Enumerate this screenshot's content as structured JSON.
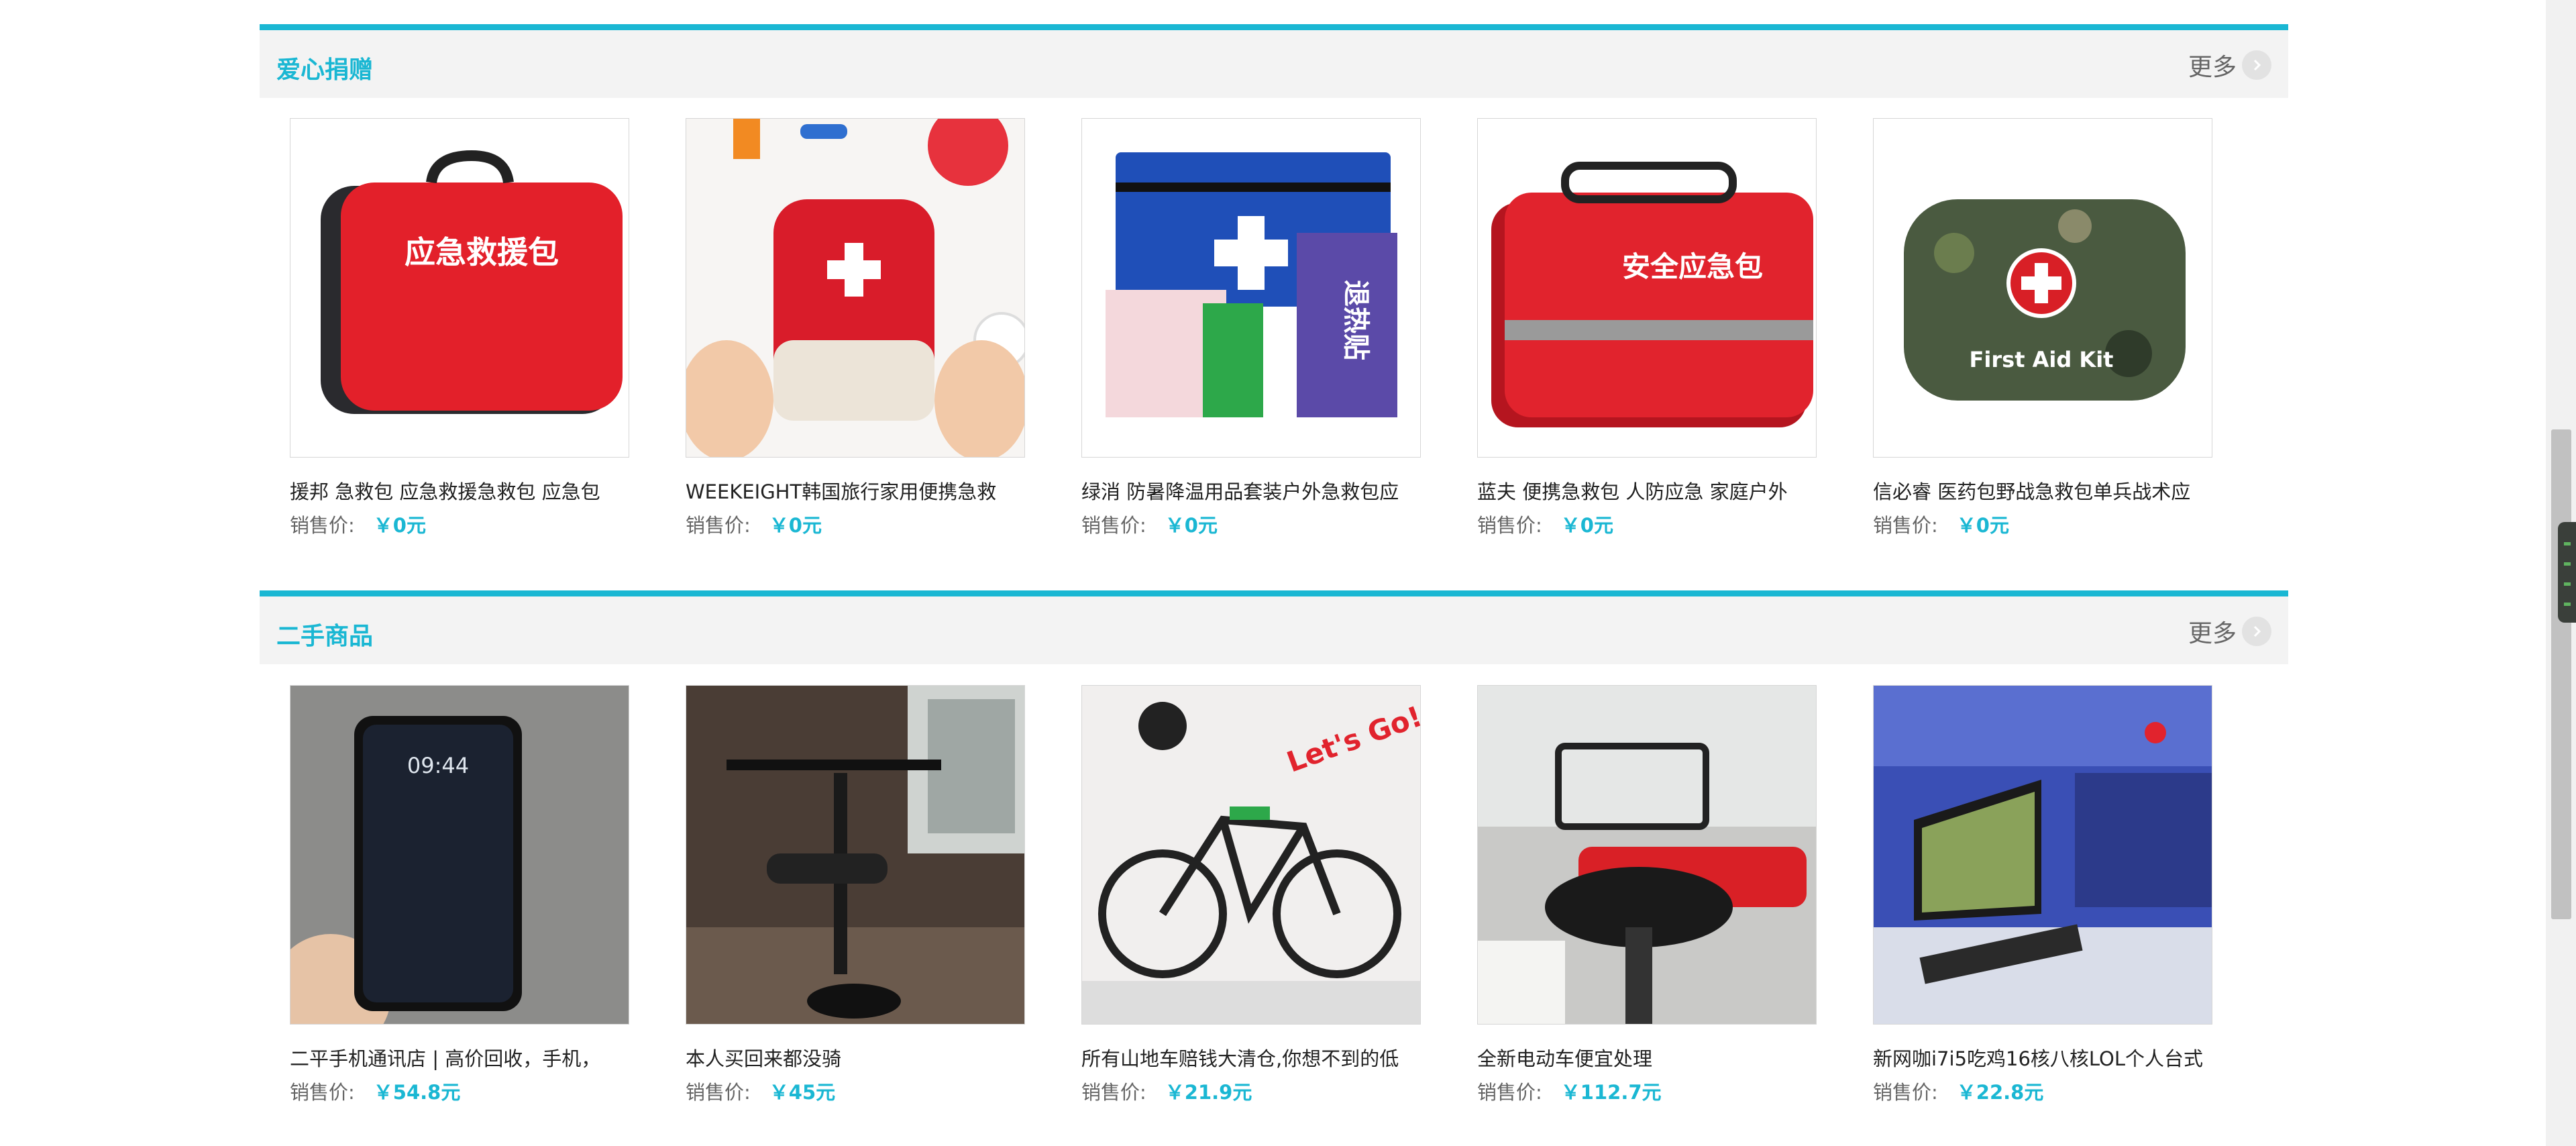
{
  "sections": [
    {
      "title": "爱心捐赠",
      "more_label": "更多",
      "products": [
        {
          "name": "援邦 急救包 应急救援急救包 应急包",
          "price_label": "销售价:",
          "price": "￥0元",
          "image": "red-first-aid-bag",
          "image_text": "应急救援包"
        },
        {
          "name": "WEEKEIGHT韩国旅行家用便携急救",
          "price_label": "销售价:",
          "price": "￥0元",
          "image": "mini-red-first-aid-pouch",
          "image_text": ""
        },
        {
          "name": "绿消 防暑降温用品套装户外急救包应",
          "price_label": "销售价:",
          "price": "￥0元",
          "image": "blue-first-aid-kit-contents",
          "image_text": "退热贴"
        },
        {
          "name": "蓝夫 便携急救包 人防应急 家庭户外",
          "price_label": "销售价:",
          "price": "￥0元",
          "image": "red-emergency-bag",
          "image_text": "安全应急包"
        },
        {
          "name": "信必睿 医药包野战急救包单兵战术应",
          "price_label": "销售价:",
          "price": "￥0元",
          "image": "camo-first-aid-pouch",
          "image_text": "First Aid Kit"
        }
      ]
    },
    {
      "title": "二手商品",
      "more_label": "更多",
      "products": [
        {
          "name": "二平手机通讯店 | 高价回收，手机，",
          "price_label": "销售价:",
          "price": "￥54.8元",
          "image": "smartphone-in-hand",
          "image_text": "09:44"
        },
        {
          "name": "本人买回来都没骑",
          "price_label": "销售价:",
          "price": "￥45元",
          "image": "electric-scooter",
          "image_text": ""
        },
        {
          "name": "所有山地车赔钱大清仓,你想不到的低",
          "price_label": "销售价:",
          "price": "￥21.9元",
          "image": "mountain-bike",
          "image_text": "Let's Go!!"
        },
        {
          "name": "全新电动车便宜处理",
          "price_label": "销售价:",
          "price": "￥112.7元",
          "image": "electric-bike",
          "image_text": ""
        },
        {
          "name": "新网咖i7i5吃鸡16核八核LOL个人台式",
          "price_label": "销售价:",
          "price": "￥22.8元",
          "image": "internet-cafe-desktop-pc",
          "image_text": ""
        }
      ]
    }
  ]
}
